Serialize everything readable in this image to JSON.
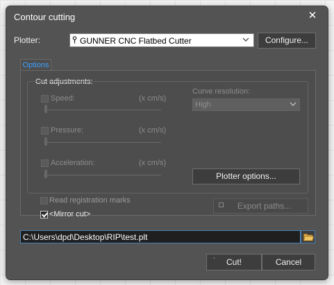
{
  "dialog": {
    "title": "Contour cutting",
    "close_glyph": "✕"
  },
  "plotter": {
    "label": "Plotter:",
    "selected": "GUNNER CNC Flatbed Cutter",
    "pin_glyph": "📍",
    "configure_label": "Configure..."
  },
  "tabs": [
    {
      "label": "Options",
      "active": true
    }
  ],
  "cut_adjustments": {
    "title": "Cut adjustments:",
    "speed": {
      "label": "Speed:",
      "unit": "(x cm/s)"
    },
    "pressure": {
      "label": "Pressure:",
      "unit": "(x cm/s)"
    },
    "acceleration": {
      "label": "Acceleration:",
      "unit": "(x cm/s)"
    },
    "curve_resolution": {
      "label": "Curve resolution:",
      "value": "High"
    },
    "plotter_options_label": "Plotter options..."
  },
  "read_registration_marks": {
    "label": "Read registration marks",
    "checked": false
  },
  "mirror_cut": {
    "label": "<Mirror cut>",
    "checked": true
  },
  "export_paths_label": "Export paths...",
  "file_path": "C:\\Users\\dpd\\Desktop\\RIP\\test.plt",
  "footer": {
    "cut_label": "Cut!",
    "cancel_label": "Cancel"
  },
  "colors": {
    "dialog_bg": "#535353",
    "accent": "#3fa2ff",
    "input_border": "#4a7fb5"
  }
}
